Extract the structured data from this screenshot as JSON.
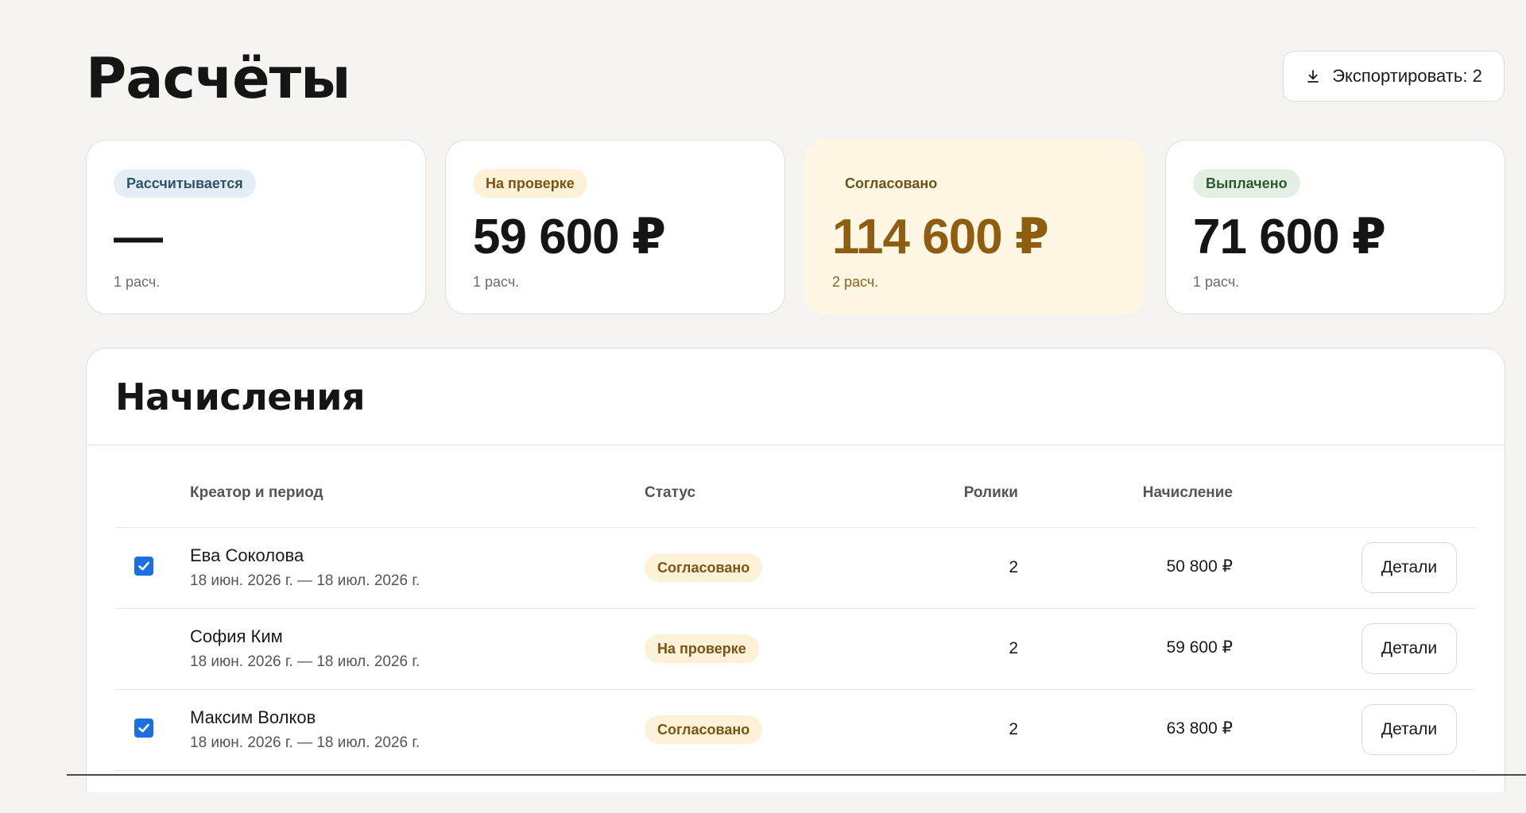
{
  "page": {
    "title": "Расчёты"
  },
  "export_button": {
    "label": "Экспортировать: 2",
    "icon": "download-icon"
  },
  "summary_cards": [
    {
      "status": "Рассчитывается",
      "value": "—",
      "count": "1 расч."
    },
    {
      "status": "На проверке",
      "value": "59 600 ₽",
      "count": "1 расч."
    },
    {
      "status": "Согласовано",
      "value": "114 600 ₽",
      "count": "2 расч."
    },
    {
      "status": "Выплачено",
      "value": "71 600 ₽",
      "count": "1 расч."
    }
  ],
  "accruals": {
    "title": "Начисления",
    "columns": {
      "creator": "Креатор и период",
      "status": "Статус",
      "videos": "Ролики",
      "amount": "Начисление"
    },
    "rows": [
      {
        "checked": true,
        "name": "Ева Соколова",
        "period": "18 июн. 2026 г. — 18 июл. 2026 г.",
        "status": "Согласовано",
        "videos": "2",
        "amount": "50 800 ₽",
        "action": "Детали"
      },
      {
        "checked": false,
        "name": "София Ким",
        "period": "18 июн. 2026 г. — 18 июл. 2026 г.",
        "status": "На проверке",
        "videos": "2",
        "amount": "59 600 ₽",
        "action": "Детали"
      },
      {
        "checked": true,
        "name": "Максим Волков",
        "period": "18 июн. 2026 г. — 18 июл. 2026 г.",
        "status": "Согласовано",
        "videos": "2",
        "amount": "63 800 ₽",
        "action": "Детали"
      }
    ]
  },
  "colors": {
    "background": "#f6f4f0",
    "accent_approved": "#8e5d10",
    "checkbox": "#1a6fe3"
  }
}
